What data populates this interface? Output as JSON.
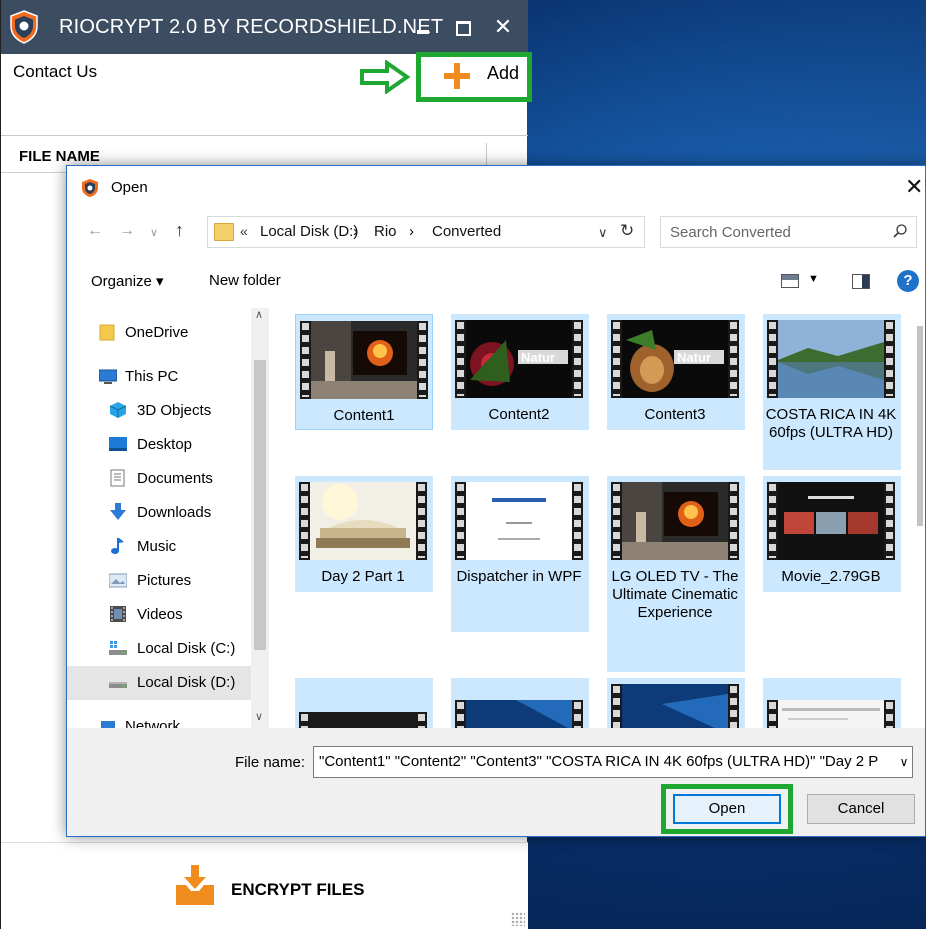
{
  "app": {
    "title": "RIOCRYPT 2.0 BY RECORDSHIELD.NET",
    "contact_label": "Contact Us",
    "add_label": "Add",
    "column_header": "FILE NAME",
    "encrypt_label": "ENCRYPT FILES",
    "minimize_glyph": "",
    "close_glyph": "✕"
  },
  "dialog": {
    "title": "Open",
    "close_glyph": "✕",
    "address": {
      "prefix": "«",
      "segments": [
        "Local Disk (D:)",
        "Rio",
        "Converted"
      ],
      "separator": "›"
    },
    "search_placeholder": "Search Converted",
    "toolbar": {
      "organize": "Organize ▾",
      "new_folder": "New folder",
      "help": "?"
    },
    "nav_items": [
      {
        "label": "OneDrive",
        "icon": "folder-icon",
        "color": "#f3c94b"
      },
      {
        "label": "This PC",
        "icon": "monitor-icon",
        "color": "#2b7bd6"
      },
      {
        "label": "3D Objects",
        "icon": "cube-icon",
        "color": "#29a4e6"
      },
      {
        "label": "Desktop",
        "icon": "desktop-icon",
        "color": "#1d7bd6"
      },
      {
        "label": "Documents",
        "icon": "document-icon",
        "color": "#8a8a8a"
      },
      {
        "label": "Downloads",
        "icon": "download-arrow-icon",
        "color": "#2b7bd6"
      },
      {
        "label": "Music",
        "icon": "music-note-icon",
        "color": "#1d6fd1"
      },
      {
        "label": "Pictures",
        "icon": "pictures-icon",
        "color": "#7f9bb8"
      },
      {
        "label": "Videos",
        "icon": "film-icon",
        "color": "#4b4b4b"
      },
      {
        "label": "Local Disk (C:)",
        "icon": "windows-drive-icon",
        "color": "#3a9ae8"
      },
      {
        "label": "Local Disk (D:)",
        "icon": "drive-icon",
        "color": "#6b6b6b"
      },
      {
        "label": "Network",
        "icon": "network-icon",
        "color": "#2b7bd6"
      }
    ],
    "files": [
      {
        "name": "Content1",
        "thumb": "tv-fire"
      },
      {
        "name": "Content2",
        "thumb": "nature-flower"
      },
      {
        "name": "Content3",
        "thumb": "nature-lion"
      },
      {
        "name": "COSTA RICA IN 4K 60fps (ULTRA HD)",
        "thumb": "lake"
      },
      {
        "name": "Day 2 Part 1",
        "thumb": "books"
      },
      {
        "name": "Dispatcher in WPF",
        "thumb": "slide"
      },
      {
        "name": "LG OLED TV - The Ultimate Cinematic Experience",
        "thumb": "tv-fire"
      },
      {
        "name": "Movie_2.79GB",
        "thumb": "movie"
      },
      {
        "name": "",
        "thumb": "dark"
      },
      {
        "name": "",
        "thumb": "windows"
      },
      {
        "name": "",
        "thumb": "windows"
      },
      {
        "name": "",
        "thumb": "screen"
      }
    ],
    "file_name_label": "File name:",
    "file_name_value": "\"Content1\" \"Content2\" \"Content3\" \"COSTA RICA IN 4K 60fps (ULTRA HD)\" \"Day 2 P",
    "open_label": "Open",
    "cancel_label": "Cancel"
  },
  "colors": {
    "highlight_green": "#1ea832",
    "accent_orange": "#f08c1e",
    "selection_blue": "#cce8ff",
    "titlebar": "#3c4c61"
  }
}
